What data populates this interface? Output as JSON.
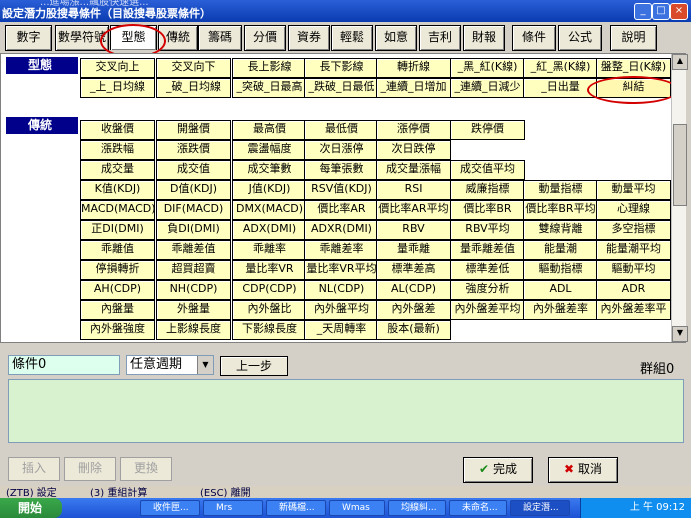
{
  "window": {
    "title": "設定潛力股搜尋條件（目設搜尋股票條件）",
    "background_text": "...進場漲...飆股快速選...",
    "controls": [
      "_",
      "□",
      "×"
    ]
  },
  "menu": [
    {
      "label": "數字"
    },
    {
      "label": "數學符號"
    },
    {
      "label": "型態",
      "active": true
    },
    {
      "label": "傳統"
    },
    {
      "label": "籌碼"
    },
    {
      "label": "分價"
    },
    {
      "label": "資券"
    },
    {
      "label": "輕鬆"
    },
    {
      "label": "如意"
    },
    {
      "label": "吉利"
    },
    {
      "label": "財報"
    },
    {
      "label": "條件"
    },
    {
      "label": "公式"
    },
    {
      "label": "說明"
    }
  ],
  "sections": {
    "pattern": {
      "heading": "型態",
      "items": [
        "交叉向上",
        "交叉向下",
        "長上影線",
        "長下影線",
        "轉折線",
        "_黑_紅(K線)",
        "_紅_黑(K線)",
        "盤整_日(K線)",
        "_上_日均線",
        "_破_日均線",
        "_突破_日最高",
        "_跌破_日最低",
        "_連續_日增加",
        "_連續_日減少",
        "_日出量",
        "糾結"
      ],
      "selected": "糾結"
    },
    "traditional": {
      "heading": "傳統",
      "rows": [
        [
          "收盤價",
          "開盤價",
          "最高價",
          "最低價",
          "漲停價",
          "跌停價"
        ],
        [
          "漲跌幅",
          "漲跌價",
          "震盪幅度",
          "次日漲停",
          "次日跌停"
        ],
        [
          "成交量",
          "成交值",
          "成交筆數",
          "每筆張數",
          "成交量漲幅",
          "成交值平均"
        ],
        [
          "K值(KDJ)",
          "D值(KDJ)",
          "J值(KDJ)",
          "RSV值(KDJ)",
          "RSI",
          "威廉指標",
          "動量指標",
          "動量平均"
        ],
        [
          "MACD(MACD)",
          "DIF(MACD)",
          "DMX(MACD)",
          "價比率AR",
          "價比率AR平均",
          "價比率BR",
          "價比率BR平均",
          "心理線"
        ],
        [
          "正DI(DMI)",
          "負DI(DMI)",
          "ADX(DMI)",
          "ADXR(DMI)",
          "RBV",
          "RBV平均",
          "雙線背離",
          "多空指標"
        ],
        [
          "乖離值",
          "乖離差值",
          "乖離率",
          "乖離差率",
          "量乖離",
          "量乖離差值",
          "能量潮",
          "能量潮平均"
        ],
        [
          "停損轉折",
          "超買超賣",
          "量比率VR",
          "量比率VR平均",
          "標準差高",
          "標準差低",
          "驅動指標",
          "驅動平均"
        ],
        [
          "AH(CDP)",
          "NH(CDP)",
          "CDP(CDP)",
          "NL(CDP)",
          "AL(CDP)",
          "強度分析",
          "ADL",
          "ADR"
        ],
        [
          "內盤量",
          "外盤量",
          "內外盤比",
          "內外盤平均",
          "內外盤差",
          "內外盤差平均",
          "內外盤差率",
          "內外盤差率平"
        ],
        [
          "內外盤強度",
          "上影線長度",
          "下影線長度",
          "_天周轉率",
          "股本(最新)"
        ]
      ]
    }
  },
  "condition": {
    "label": "條件0",
    "period": "任意週期",
    "prev_button": "上一步",
    "group_label": "群組0"
  },
  "bottom_buttons": {
    "insert": "插入",
    "delete": "刪除",
    "replace": "更換",
    "done": "完成",
    "cancel": "取消"
  },
  "back_window_text": [
    "(ZTB) 設定",
    "(3) 重組計算",
    "(ESC) 離開"
  ],
  "taskbar": {
    "start": "開始",
    "tasks": [
      "收件匣...",
      "Mrs",
      "新碼檔...",
      "Wmas",
      "均線糾...",
      "未命名...",
      "設定潛..."
    ],
    "tray": "上 午 09:12"
  }
}
